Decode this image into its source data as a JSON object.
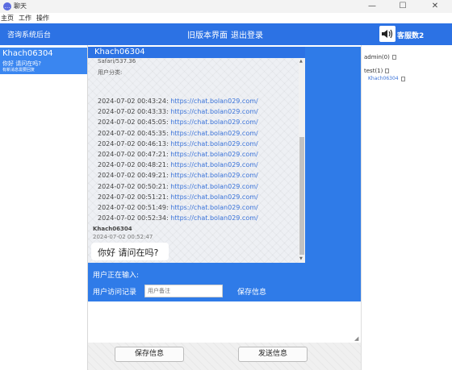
{
  "window": {
    "title": "聊天",
    "minimize": "—",
    "maximize": "☐",
    "close": "✕"
  },
  "menu": {
    "items": [
      "主页",
      "工作",
      "操作"
    ]
  },
  "topbar": {
    "left_title": "咨询系统后台",
    "old_ui_link": "旧版本界面",
    "logout_link": "退出登录",
    "service_label": "客服数2"
  },
  "sidebar": {
    "selected": {
      "name": "Khach06304",
      "last_message": "你好 请问在吗?",
      "status": "有新消息需要回复"
    }
  },
  "chat": {
    "contact": "Khach06304",
    "user_agent_tail": "Safari/537.36",
    "user_group": "用户分类:",
    "visits": [
      {
        "time": "2024-07-02 00:43:24:",
        "url": "https://chat.bolan029.com/"
      },
      {
        "time": "2024-07-02 00:43:33:",
        "url": "https://chat.bolan029.com/"
      },
      {
        "time": "2024-07-02 00:45:05:",
        "url": "https://chat.bolan029.com/"
      },
      {
        "time": "2024-07-02 00:45:35:",
        "url": "https://chat.bolan029.com/"
      },
      {
        "time": "2024-07-02 00:46:13:",
        "url": "https://chat.bolan029.com/"
      },
      {
        "time": "2024-07-02 00:47:21:",
        "url": "https://chat.bolan029.com/"
      },
      {
        "time": "2024-07-02 00:48:21:",
        "url": "https://chat.bolan029.com/"
      },
      {
        "time": "2024-07-02 00:49:21:",
        "url": "https://chat.bolan029.com/"
      },
      {
        "time": "2024-07-02 00:50:21:",
        "url": "https://chat.bolan029.com/"
      },
      {
        "time": "2024-07-02 00:51:21:",
        "url": "https://chat.bolan029.com/"
      },
      {
        "time": "2024-07-02 00:51:49:",
        "url": "https://chat.bolan029.com/"
      },
      {
        "time": "2024-07-02 00:52:34:",
        "url": "https://chat.bolan029.com/"
      }
    ],
    "message": {
      "sender": "Khach06304",
      "time": "2024-07-02 00:52:47",
      "text": "你好 请问在吗?"
    }
  },
  "input_bar": {
    "typing_label": "用户正在输入:",
    "visit_record_label": "用户访问记录",
    "note_placeholder": "用户备注",
    "save_label": "保存信息"
  },
  "bottom": {
    "save_button": "保存信息",
    "send_button": "发送信息"
  },
  "right_panel": {
    "groups": [
      {
        "label": "admin(0)"
      },
      {
        "label": "test(1)"
      }
    ],
    "users": [
      {
        "label": "Khach06304"
      }
    ]
  },
  "colors": {
    "accent_blue": "#2c72e4",
    "link_blue": "#3a73d9"
  }
}
